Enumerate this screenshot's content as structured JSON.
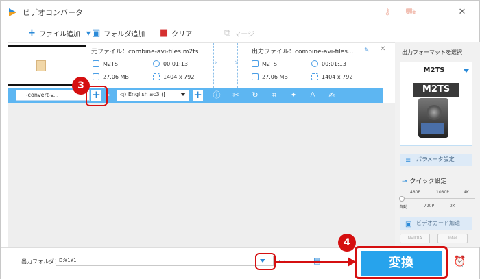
{
  "window": {
    "title": "ビデオコンバータ"
  },
  "toolbar": {
    "add_file": "ファイル追加",
    "add_folder": "フォルダ追加",
    "clear": "クリア",
    "merge": "マージ"
  },
  "file_item": {
    "source_label": "元ファイル：combine-avi-files.m2ts",
    "output_label": "出力ファイル：combine-avi-files...",
    "source": {
      "format": "M2TS",
      "duration": "00:01:13",
      "size": "27.06 MB",
      "resolution": "1404 x 792"
    },
    "output": {
      "format": "M2TS",
      "duration": "00:01:13",
      "size": "27.06 MB",
      "resolution": "1404 x 792"
    }
  },
  "editbar": {
    "subtitle_value": "l-convert-v...",
    "audio_value": "English ac3 ([",
    "plus_symbol": "+"
  },
  "right_panel": {
    "select_format_label": "出力フォーマットを選択",
    "format_name": "M2TS",
    "format_badge": "M2TS",
    "param_label": "パラメータ設定",
    "quick_label": "クイック設定",
    "res_top": [
      "480P",
      "1080P",
      "4K"
    ],
    "res_bottom": [
      "自動",
      "720P",
      "2K"
    ],
    "quick_level": 0,
    "gpu_label": "ビデオカード加速",
    "gpu_nvidia": "NVIDIA",
    "gpu_intel": "Intel"
  },
  "bottom": {
    "output_folder_label": "出力フォルダ：",
    "output_path": "D:¥1¥1",
    "convert_label": "変換"
  },
  "annotations": {
    "step3": "3",
    "step4": "4"
  },
  "colors": {
    "accent": "#27a3ec",
    "editbar": "#5db6f2",
    "annotation_red": "#d50f10"
  }
}
